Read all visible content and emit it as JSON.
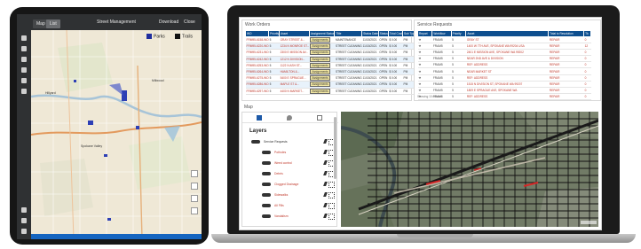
{
  "tablet": {
    "topbar": {
      "left_btn_1": "Map",
      "left_btn_2": "List",
      "title": "Street Management",
      "download": "Download",
      "close": "Close"
    },
    "legend": {
      "item1": "Parks",
      "item2": "Trails"
    },
    "map_labels": {
      "place1": "Hillyard",
      "place2": "Spokane Valley",
      "place3": "Millwood"
    }
  },
  "work_orders": {
    "title": "Work Orders",
    "columns": [
      "WO",
      "Priority",
      "Asset",
      "Assignment Status",
      "Title",
      "Status Date",
      "Status",
      "Total Cost",
      "Sub Type"
    ],
    "rows": [
      [
        "FRM95-6158-WO",
        "5",
        "GRAY STREET &...",
        "Assignments",
        "MAINTENANCE",
        "11/15/2021",
        "OPEN",
        "$ 0.00",
        "PM"
      ],
      [
        "FRM95-6220-WO",
        "5",
        "1234 N MONROE ST...",
        "Assignments",
        "STREET CLEANING",
        "11/15/2021",
        "OPEN",
        "$ 0.00",
        "PM"
      ],
      [
        "FRM95-6231-WO",
        "5",
        "2300 E MISSION AV...",
        "Assignments",
        "STREET CLEANING",
        "11/15/2021",
        "OPEN",
        "$ 0.00",
        "PM"
      ],
      [
        "FRM95-6242-WO",
        "5",
        "1212 N DIVISION...",
        "Assignments",
        "STREET CLEANING",
        "11/15/2021",
        "OPEN",
        "$ 0.00",
        "PM"
      ],
      [
        "FRM95-6253-WO",
        "5",
        "1122 N ASH ST...",
        "Assignments",
        "STREET CLEANING",
        "11/15/2021",
        "OPEN",
        "$ 0.00",
        "PM"
      ],
      [
        "FRM95-6264-WO",
        "5",
        "HAMILTON &...",
        "Assignments",
        "STREET CLEANING",
        "11/15/2021",
        "OPEN",
        "$ 0.00",
        "PM"
      ],
      [
        "FRM95-6275-WO",
        "5",
        "5400 E SPRAGUE...",
        "Assignments",
        "STREET CLEANING",
        "11/15/2021",
        "OPEN",
        "$ 0.00",
        "PM"
      ],
      [
        "FRM95-6286-WO",
        "5",
        "MAPLE ST &...",
        "Assignments",
        "STREET CLEANING",
        "11/15/2021",
        "OPEN",
        "$ 0.00",
        "PM"
      ],
      [
        "FRM95-6297-WO",
        "5",
        "4400 N MARKET...",
        "Assignments",
        "STREET CLEANING",
        "11/15/2021",
        "OPEN",
        "$ 0.00",
        "PM"
      ]
    ]
  },
  "service_requests": {
    "title": "Service Requests",
    "columns": [
      "Report",
      "Workflow",
      "Priority",
      "Asset",
      "Total to Resolution",
      "Tk"
    ],
    "rows": [
      [
        "FRAM5",
        "5",
        "GRAY ST",
        "REPAIR",
        "0"
      ],
      [
        "FRAM5",
        "5",
        "1400 W 7TH AVE, SPOKANE WA 99204 USA",
        "REPAIR",
        "12"
      ],
      [
        "FRAM5",
        "5",
        "2401 E MISSION AVE, SPOKANE WA 99202",
        "REPAIR",
        "0"
      ],
      [
        "FRAM5",
        "5",
        "NEAR 2ND AVE & DIVISION",
        "REPAIR",
        "0"
      ],
      [
        "FRAM5",
        "5",
        "REF: ADDRESS",
        "REPAIR",
        "0"
      ],
      [
        "FRAM5",
        "5",
        "NEAR MARKET ST",
        "REPAIR",
        "0"
      ],
      [
        "FRAM5",
        "5",
        "REF: ADDRESS",
        "REPAIR",
        "0"
      ],
      [
        "FRAM5",
        "5",
        "1515 N DIVISION ST, SPOKANE WA 99207",
        "REPAIR",
        "0"
      ],
      [
        "FRAM5",
        "5",
        "1809 E SPRAGUE AVE, SPOKANE WA",
        "REPAIR",
        "0"
      ],
      [
        "FRAM5",
        "5",
        "REF: ADDRESS",
        "REPAIR",
        "0"
      ]
    ],
    "footer": "Showing 10 records"
  },
  "map_panel": {
    "title": "Map",
    "layers_title": "Layers",
    "layers": [
      {
        "label": "Service Requests"
      },
      {
        "label": "Potholes"
      },
      {
        "label": "Weed control"
      },
      {
        "label": "Debris"
      },
      {
        "label": "Clogged Drainage"
      },
      {
        "label": "Sidewalks"
      },
      {
        "label": "All Fills"
      },
      {
        "label": "Vandalism"
      }
    ]
  },
  "colors": {
    "header_blue": "#0e4f8f",
    "accent_red": "#c0392b",
    "assign_yellow": "#f2e7a2",
    "tablet_bar_blue": "#1565c0"
  }
}
